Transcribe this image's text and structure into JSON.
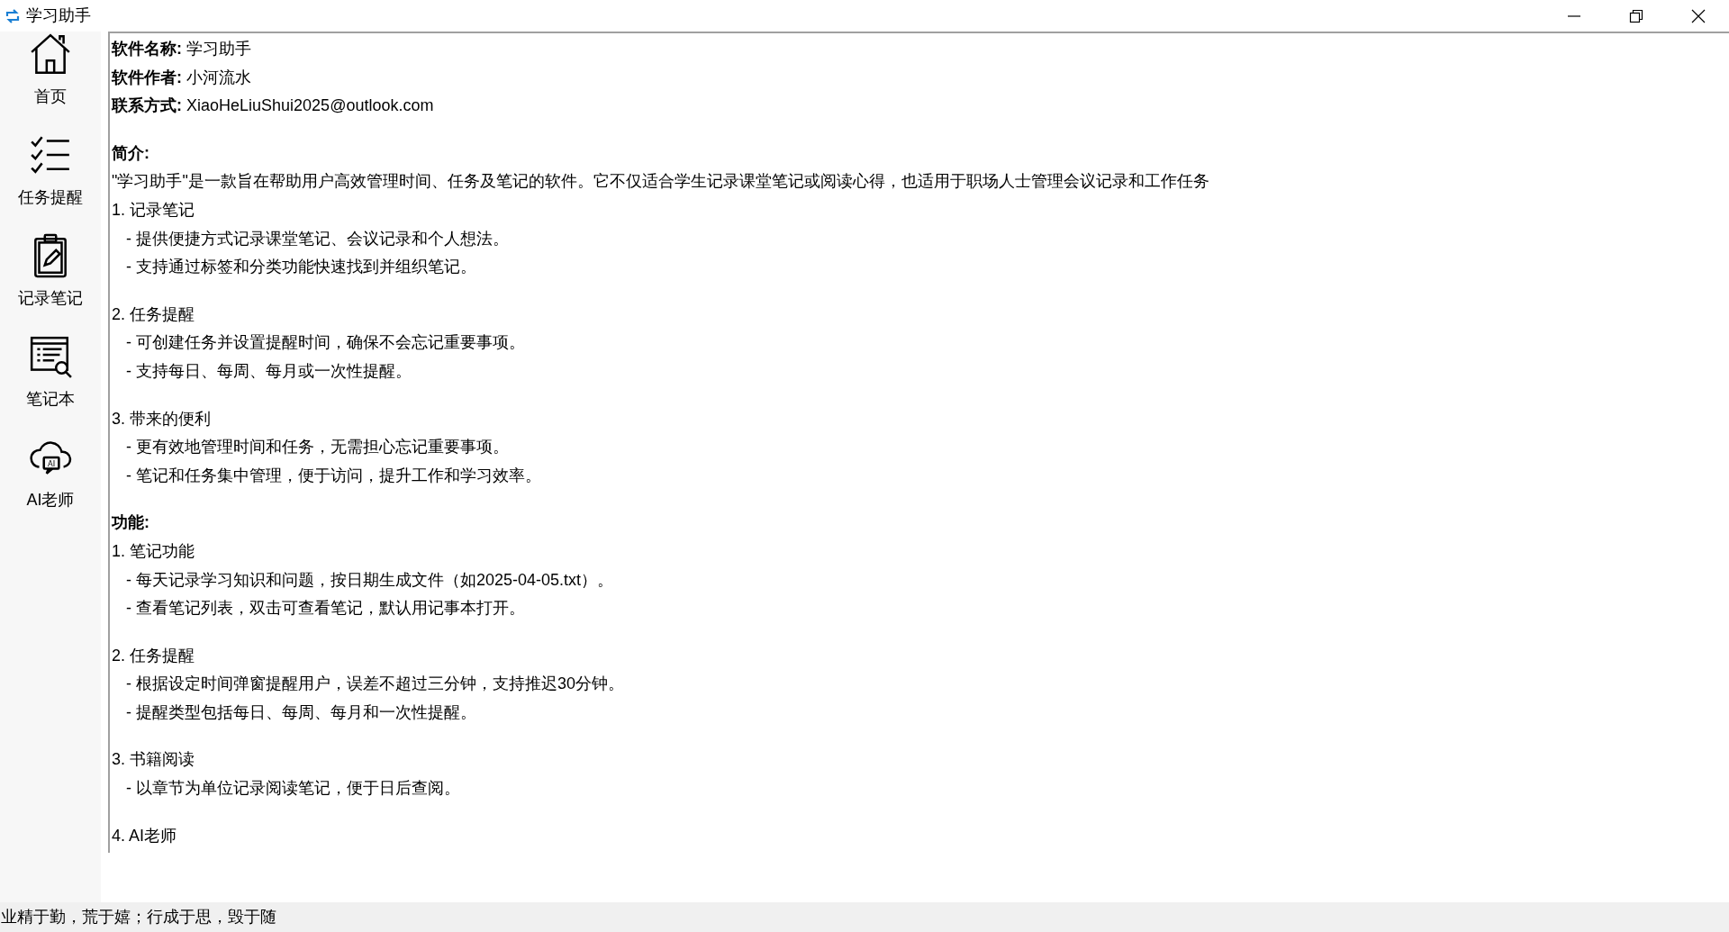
{
  "window": {
    "title": "学习助手"
  },
  "sidebar": {
    "items": [
      {
        "kind": "home",
        "label": "首页"
      },
      {
        "kind": "tasks",
        "label": "任务提醒"
      },
      {
        "kind": "clipboard",
        "label": "记录笔记"
      },
      {
        "kind": "notebook",
        "label": "笔记本"
      },
      {
        "kind": "ai",
        "label": "AI老师",
        "icon_text": "AI"
      }
    ]
  },
  "content": {
    "lines": [
      {
        "kind": "field",
        "label": "软件名称:",
        "value": "学习助手"
      },
      {
        "kind": "field",
        "label": "软件作者:",
        "value": "小河流水"
      },
      {
        "kind": "field",
        "label": "联系方式:",
        "value": "XiaoHeLiuShui2025@outlook.com"
      },
      {
        "kind": "blank"
      },
      {
        "kind": "heading",
        "text": "简介:"
      },
      {
        "kind": "text",
        "text": "\"学习助手\"是一款旨在帮助用户高效管理时间、任务及笔记的软件。它不仅适合学生记录课堂笔记或阅读心得，也适用于职场人士管理会议记录和工作任务"
      },
      {
        "kind": "text",
        "text": "1. 记录笔记"
      },
      {
        "kind": "item",
        "text": "- 提供便捷方式记录课堂笔记、会议记录和个人想法。"
      },
      {
        "kind": "item",
        "text": "- 支持通过标签和分类功能快速找到并组织笔记。"
      },
      {
        "kind": "blank"
      },
      {
        "kind": "text",
        "text": "2. 任务提醒"
      },
      {
        "kind": "item",
        "text": "- 可创建任务并设置提醒时间，确保不会忘记重要事项。"
      },
      {
        "kind": "item",
        "text": "- 支持每日、每周、每月或一次性提醒。"
      },
      {
        "kind": "blank"
      },
      {
        "kind": "text",
        "text": "3. 带来的便利"
      },
      {
        "kind": "item",
        "text": "- 更有效地管理时间和任务，无需担心忘记重要事项。"
      },
      {
        "kind": "item",
        "text": "- 笔记和任务集中管理，便于访问，提升工作和学习效率。"
      },
      {
        "kind": "blank"
      },
      {
        "kind": "heading",
        "text": "功能:"
      },
      {
        "kind": "text",
        "text": "1. 笔记功能"
      },
      {
        "kind": "item",
        "text": "- 每天记录学习知识和问题，按日期生成文件（如2025-04-05.txt）。"
      },
      {
        "kind": "item",
        "text": "- 查看笔记列表，双击可查看笔记，默认用记事本打开。"
      },
      {
        "kind": "blank"
      },
      {
        "kind": "text",
        "text": "2. 任务提醒"
      },
      {
        "kind": "item",
        "text": "- 根据设定时间弹窗提醒用户，误差不超过三分钟，支持推迟30分钟。"
      },
      {
        "kind": "item",
        "text": "- 提醒类型包括每日、每周、每月和一次性提醒。"
      },
      {
        "kind": "blank"
      },
      {
        "kind": "text",
        "text": "3. 书籍阅读"
      },
      {
        "kind": "item",
        "text": "- 以章节为单位记录阅读笔记，便于日后查阅。"
      },
      {
        "kind": "blank"
      },
      {
        "kind": "text",
        "text": "4. AI老师"
      }
    ]
  },
  "status_bar": {
    "text": "业精于勤，荒于嬉；行成于思，毁于随"
  }
}
